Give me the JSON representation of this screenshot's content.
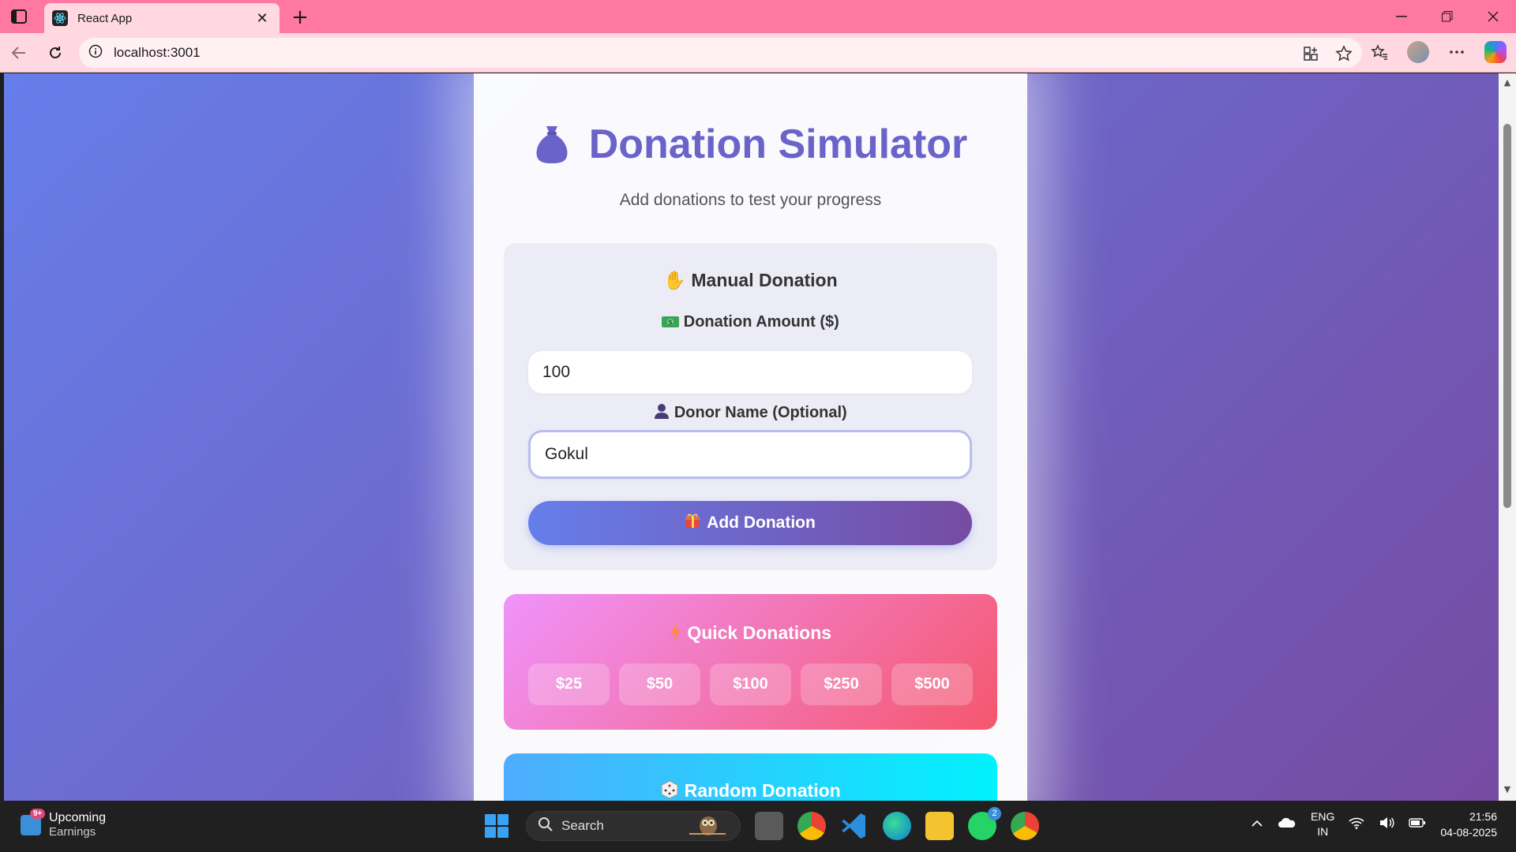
{
  "browser": {
    "tab_title": "React App",
    "address": "localhost:3001"
  },
  "page": {
    "title": "Donation Simulator",
    "subtitle": "Add donations to test your progress",
    "manual": {
      "title": "Manual Donation",
      "amount_label": "Donation Amount ($)",
      "amount_value": "100",
      "donor_label": "Donor Name (Optional)",
      "donor_value": "Gokul",
      "add_button": "Add Donation"
    },
    "quick": {
      "title": "Quick Donations",
      "amounts": [
        "$25",
        "$50",
        "$100",
        "$250",
        "$500"
      ]
    },
    "random": {
      "title": "Random Donation"
    }
  },
  "taskbar": {
    "widget_title": "Upcoming",
    "widget_subtitle": "Earnings",
    "widget_badge": "9+",
    "search_placeholder": "Search",
    "whatsapp_badge": "2",
    "lang_line1": "ENG",
    "lang_line2": "IN",
    "time": "21:56",
    "date": "04-08-2025"
  },
  "colors": {
    "bg_gradient_start": "#667eea",
    "bg_gradient_end": "#764ba2",
    "title_color": "#6a63c9",
    "quick_gradient_start": "#f093fb",
    "quick_gradient_end": "#f5576c",
    "random_gradient_start": "#4facfe",
    "random_gradient_end": "#00f2fe",
    "browser_accent": "#ff78a2"
  },
  "icons": {
    "title": "money-bag-icon",
    "manual": "raised-hand-icon",
    "amount": "dollar-banknote-icon",
    "donor": "person-silhouette-icon",
    "add": "gift-icon",
    "quick": "lightning-icon",
    "random": "dice-icon"
  }
}
